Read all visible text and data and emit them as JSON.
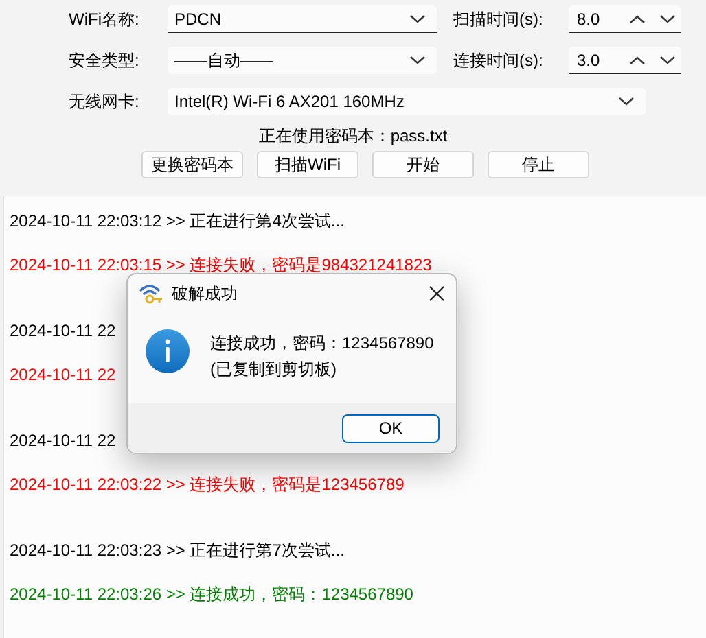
{
  "form": {
    "rows": [
      {
        "label": "WiFi名称:",
        "combo": {
          "value": "PDCN",
          "editable": true
        },
        "spin": {
          "label": "扫描时间(s):",
          "value": "8.0"
        }
      },
      {
        "label": "安全类型:",
        "combo": {
          "value": "——自动——",
          "editable": false
        },
        "spin": {
          "label": "连接时间(s):",
          "value": "3.0"
        }
      },
      {
        "label": "无线网卡:",
        "combo": {
          "value": "Intel(R) Wi-Fi 6 AX201 160MHz",
          "editable": false
        }
      }
    ],
    "dictionary_info": "正在使用密码本：pass.txt",
    "buttons": [
      "更换密码本",
      "扫描WiFi",
      "开始",
      "停止"
    ]
  },
  "log": [
    {
      "kind": "info",
      "text": "2024-10-11 22:03:12 >> 正在进行第4次尝试..."
    },
    {
      "kind": "fail",
      "text": "2024-10-11 22:03:15 >> 连接失败，密码是984321241823"
    },
    {
      "kind": "info",
      "text": "2024-10-11 22"
    },
    {
      "kind": "fail",
      "text": "2024-10-11 22"
    },
    {
      "kind": "info",
      "text": "2024-10-11 22"
    },
    {
      "kind": "fail",
      "text": "2024-10-11 22:03:22 >> 连接失败，密码是123456789"
    },
    {
      "kind": "info",
      "text": "2024-10-11 22:03:23 >> 正在进行第7次尝试..."
    },
    {
      "kind": "success",
      "text": "2024-10-11 22:03:26 >> 连接成功，密码：1234567890"
    }
  ],
  "dialog": {
    "title": "破解成功",
    "message": [
      "连接成功，密码：1234567890",
      "(已复制到剪切板)"
    ],
    "button": "OK"
  }
}
